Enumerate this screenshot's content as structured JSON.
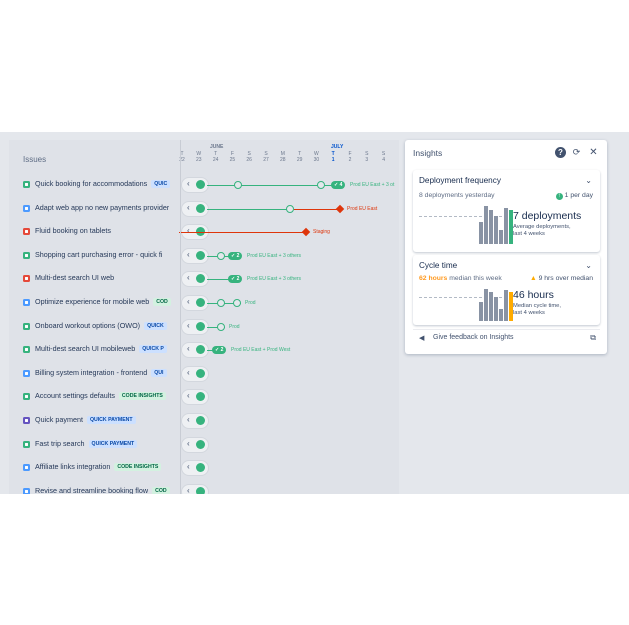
{
  "issues_header": "Issues",
  "timeline": {
    "months": [
      {
        "label": "JUNE",
        "active": false
      },
      {
        "label": "JULY",
        "active": true
      }
    ],
    "day_letters": [
      "T",
      "W",
      "T",
      "F",
      "S",
      "S",
      "M",
      "T",
      "W",
      "T",
      "F",
      "S",
      "S"
    ],
    "day_numbers": [
      "22",
      "23",
      "24",
      "25",
      "26",
      "27",
      "28",
      "29",
      "30",
      "1",
      "2",
      "3",
      "4"
    ]
  },
  "issues": [
    {
      "title": "Quick booking for accommodations",
      "lozenge": "QUIC",
      "lozenge_color": "blue",
      "type": "story",
      "env": "Prod EU East + 3 ot",
      "status": "deployed"
    },
    {
      "title": "Adapt web app no new payments provider",
      "lozenge": "",
      "lozenge_color": "",
      "type": "subtask",
      "env": "Prod EU East",
      "status": "failed"
    },
    {
      "title": "Fluid booking on tablets",
      "lozenge": "",
      "lozenge_color": "",
      "type": "bug",
      "env": "Staging",
      "status": "failed"
    },
    {
      "title": "Shopping cart purchasing error - quick fi",
      "lozenge": "",
      "lozenge_color": "",
      "type": "story",
      "env": "Prod EU East + 3 others",
      "status": "deployed"
    },
    {
      "title": "Multi-dest search UI web",
      "lozenge": "",
      "lozenge_color": "",
      "type": "bug",
      "env": "Prod EU East + 3 others",
      "status": "deployed"
    },
    {
      "title": "Optimize experience for mobile web",
      "lozenge": "COD",
      "lozenge_color": "green",
      "type": "task",
      "env": "Prod",
      "status": "deployed"
    },
    {
      "title": "Onboard workout options (OWO)",
      "lozenge": "QUICK",
      "lozenge_color": "blue",
      "type": "story",
      "env": "Prod",
      "status": "deployed"
    },
    {
      "title": "Multi-dest search UI mobileweb",
      "lozenge": "QUICK P",
      "lozenge_color": "blue",
      "type": "story",
      "env": "Prod EU East + Prod West",
      "status": "deployed"
    },
    {
      "title": "Billing system integration - frontend",
      "lozenge": "QUI",
      "lozenge_color": "blue",
      "type": "task",
      "env": "",
      "status": "none"
    },
    {
      "title": "Account settings defaults",
      "lozenge": "CODE INSIGHTS",
      "lozenge_color": "green",
      "type": "story",
      "env": "",
      "status": "none"
    },
    {
      "title": "Quick payment",
      "lozenge": "QUICK PAYMENT",
      "lozenge_color": "blue",
      "type": "epic",
      "env": "",
      "status": "none"
    },
    {
      "title": "Fast trip search",
      "lozenge": "QUICK PAYMENT",
      "lozenge_color": "blue",
      "type": "story",
      "env": "",
      "status": "none"
    },
    {
      "title": "Affiliate links integration",
      "lozenge": "CODE INSIGHTS",
      "lozenge_color": "green",
      "type": "subtask",
      "env": "",
      "status": "none"
    },
    {
      "title": "Revise and streamline booking flow",
      "lozenge": "COD",
      "lozenge_color": "green",
      "type": "task",
      "env": "",
      "status": "none"
    }
  ],
  "pill_counts": {
    "r0": "4",
    "r3": "2",
    "r4": "2",
    "r7": "2"
  },
  "insights": {
    "title": "Insights",
    "deploy": {
      "title": "Deployment frequency",
      "summary": "8 deployments yesterday",
      "rate": "1 per day",
      "big": "7 deployments",
      "caption1": "Average deployments,",
      "caption2": "last 4 weeks",
      "bars": [
        0.55,
        0.95,
        0.85,
        0.7,
        0.35,
        0.9
      ],
      "highlight_color": "#36b37e"
    },
    "cycle": {
      "title": "Cycle time",
      "median_hours": "62 hours",
      "median_text": "median this week",
      "over": "9 hrs over median",
      "big": "46 hours",
      "caption1": "Median cycle time,",
      "caption2": "last 4 weeks",
      "bars": [
        0.55,
        0.95,
        0.85,
        0.7,
        0.35,
        0.9
      ],
      "highlight_color": "#ffab00"
    },
    "feedback": "Give feedback on Insights"
  }
}
